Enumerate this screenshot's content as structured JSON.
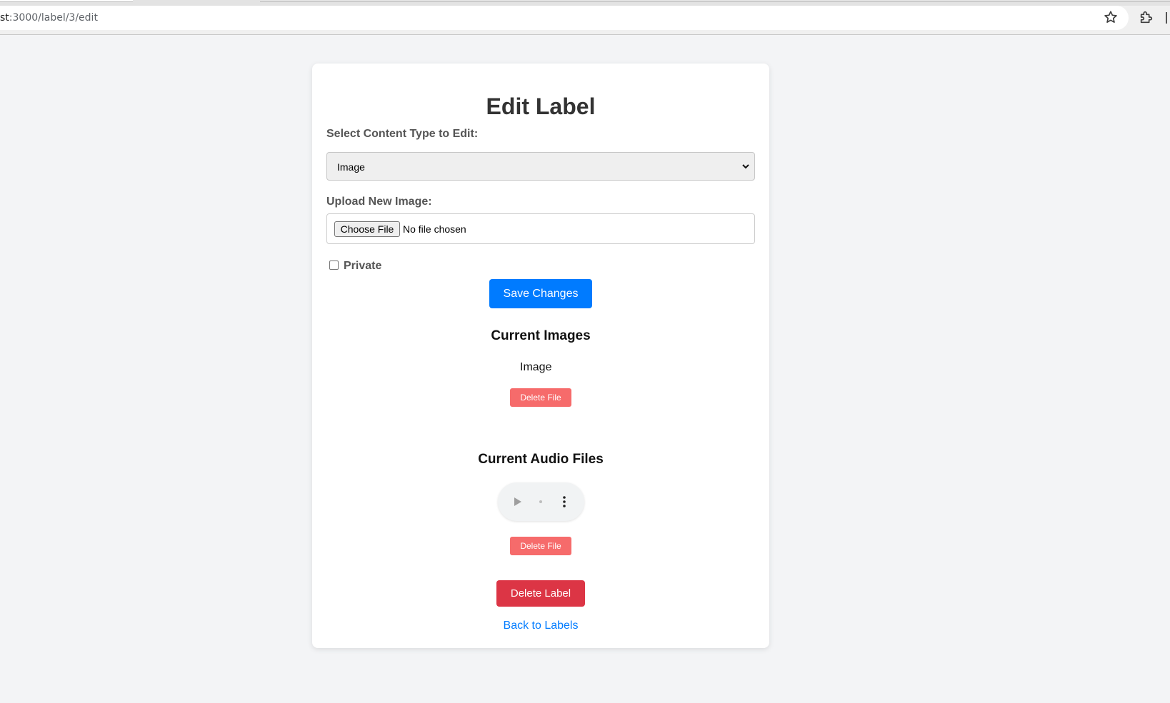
{
  "browser": {
    "url_host": "st",
    "url_rest": ":3000/label/3/edit",
    "icons": [
      "star-icon",
      "extension-icon"
    ]
  },
  "page": {
    "title": "Edit Label",
    "content_type_label": "Select Content Type to Edit:",
    "content_type_selected": "Image",
    "upload_label": "Upload New Image:",
    "choose_file_label": "Choose File",
    "file_status": "No file chosen",
    "private_label": "Private",
    "private_checked": false,
    "save_label": "Save Changes",
    "current_images_heading": "Current Images",
    "image_alt": "Image",
    "delete_file_label": "Delete File",
    "current_audio_heading": "Current Audio Files",
    "delete_label_label": "Delete Label",
    "back_link_label": "Back to Labels"
  },
  "colors": {
    "primary": "#007bff",
    "danger": "#dc3545",
    "danger_light": "#f66b6b",
    "background": "#f3f4f6"
  }
}
